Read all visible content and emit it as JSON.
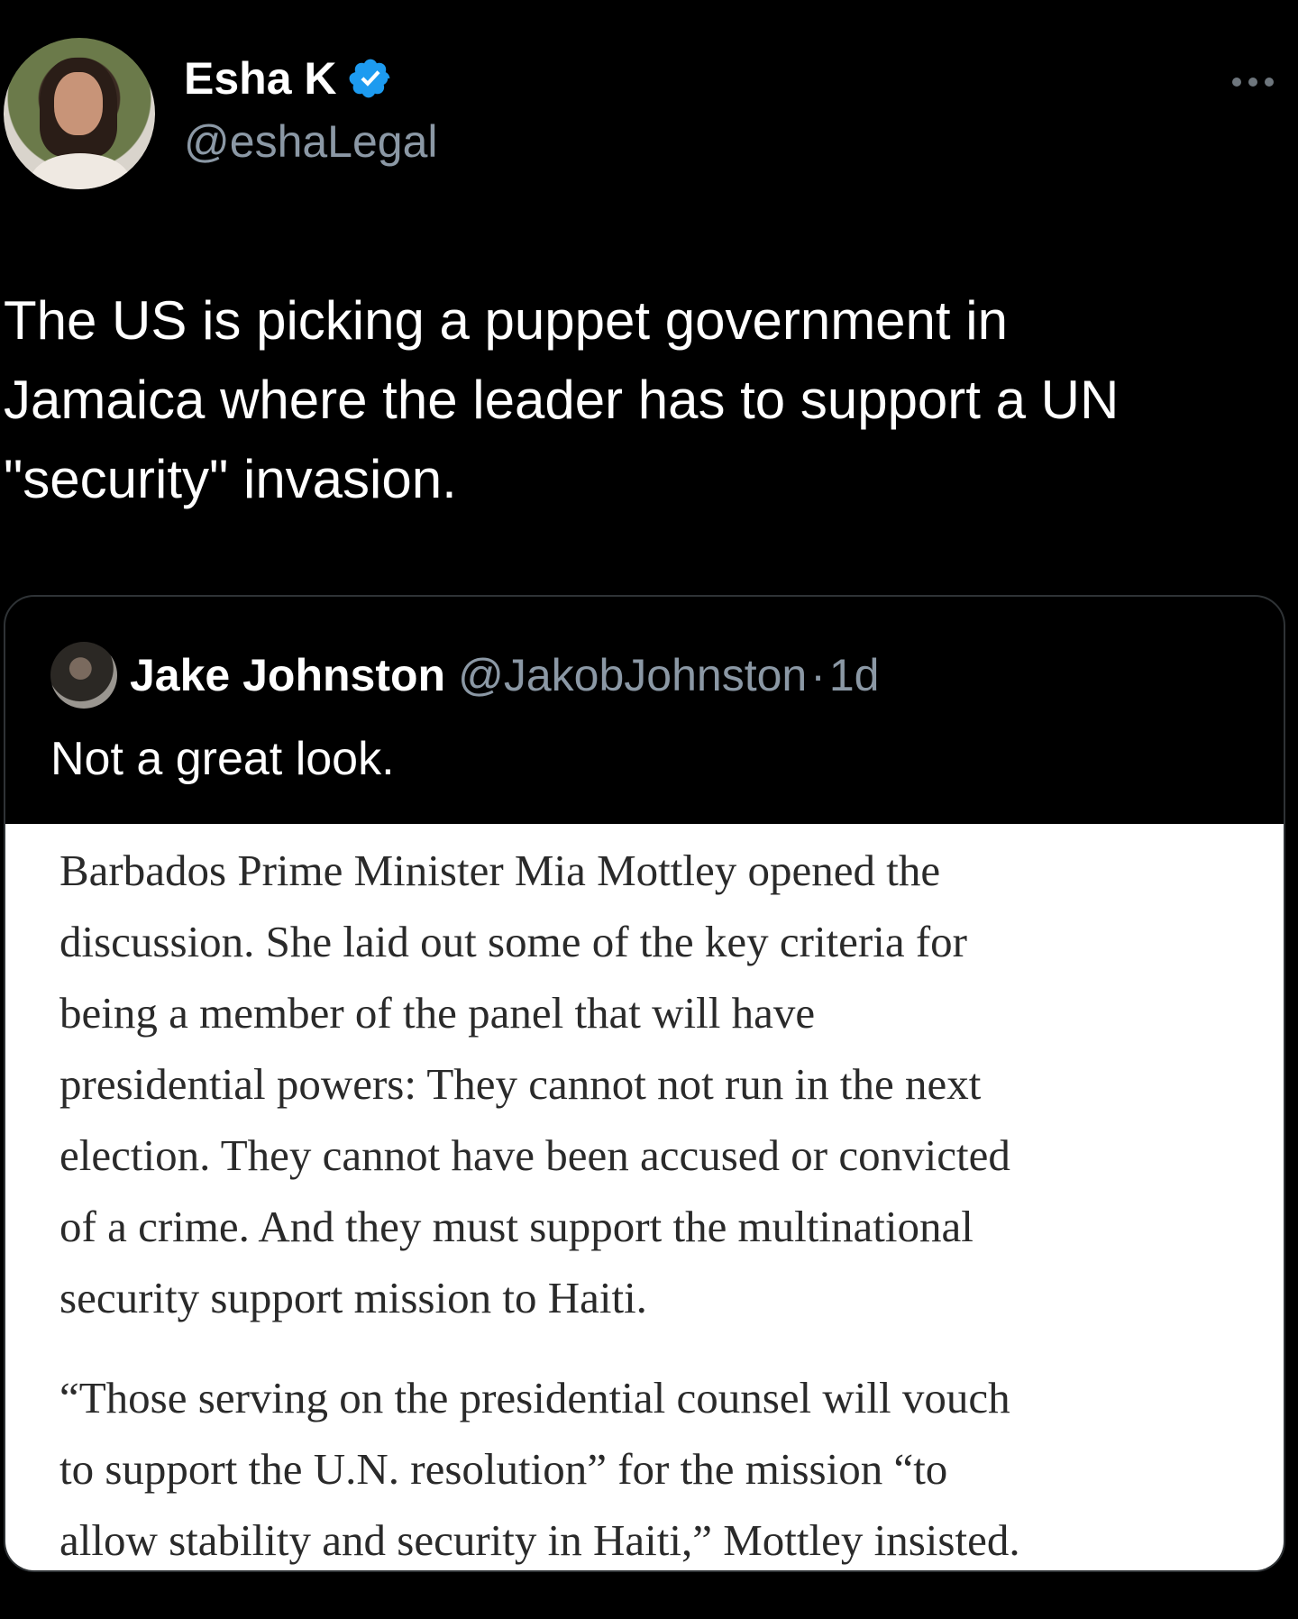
{
  "author": {
    "name": "Esha K",
    "handle": "@eshaLegal",
    "verified_icon": "verified-badge-icon",
    "verified_color": "#1d9bf0"
  },
  "tweet": {
    "text_lines": [
      "The US is picking a puppet government in",
      "Jamaica where the leader has to support a UN",
      "\"security\" invasion."
    ]
  },
  "quoted": {
    "name": "Jake Johnston",
    "handle": "@JakobJohnston",
    "separator": "·",
    "time": "1d",
    "text": "Not a great look.",
    "article_lines_p1": [
      "Barbados Prime Minister Mia Mottley opened the",
      "discussion. She laid out some of the key criteria for",
      "being a member of the panel that will have",
      "presidential powers: They cannot not run in the next",
      "election. They cannot have been accused or convicted",
      "of a crime. And they must support the multinational",
      "security support mission to Haiti."
    ],
    "article_lines_p2": [
      "“Those serving on the presidential counsel will vouch",
      "to support the U.N. resolution” for the mission “to",
      "allow stability and security in Haiti,” Mottley insisted."
    ]
  },
  "colors": {
    "background": "#000000",
    "muted": "#8b98a5",
    "text": "#ffffff"
  }
}
